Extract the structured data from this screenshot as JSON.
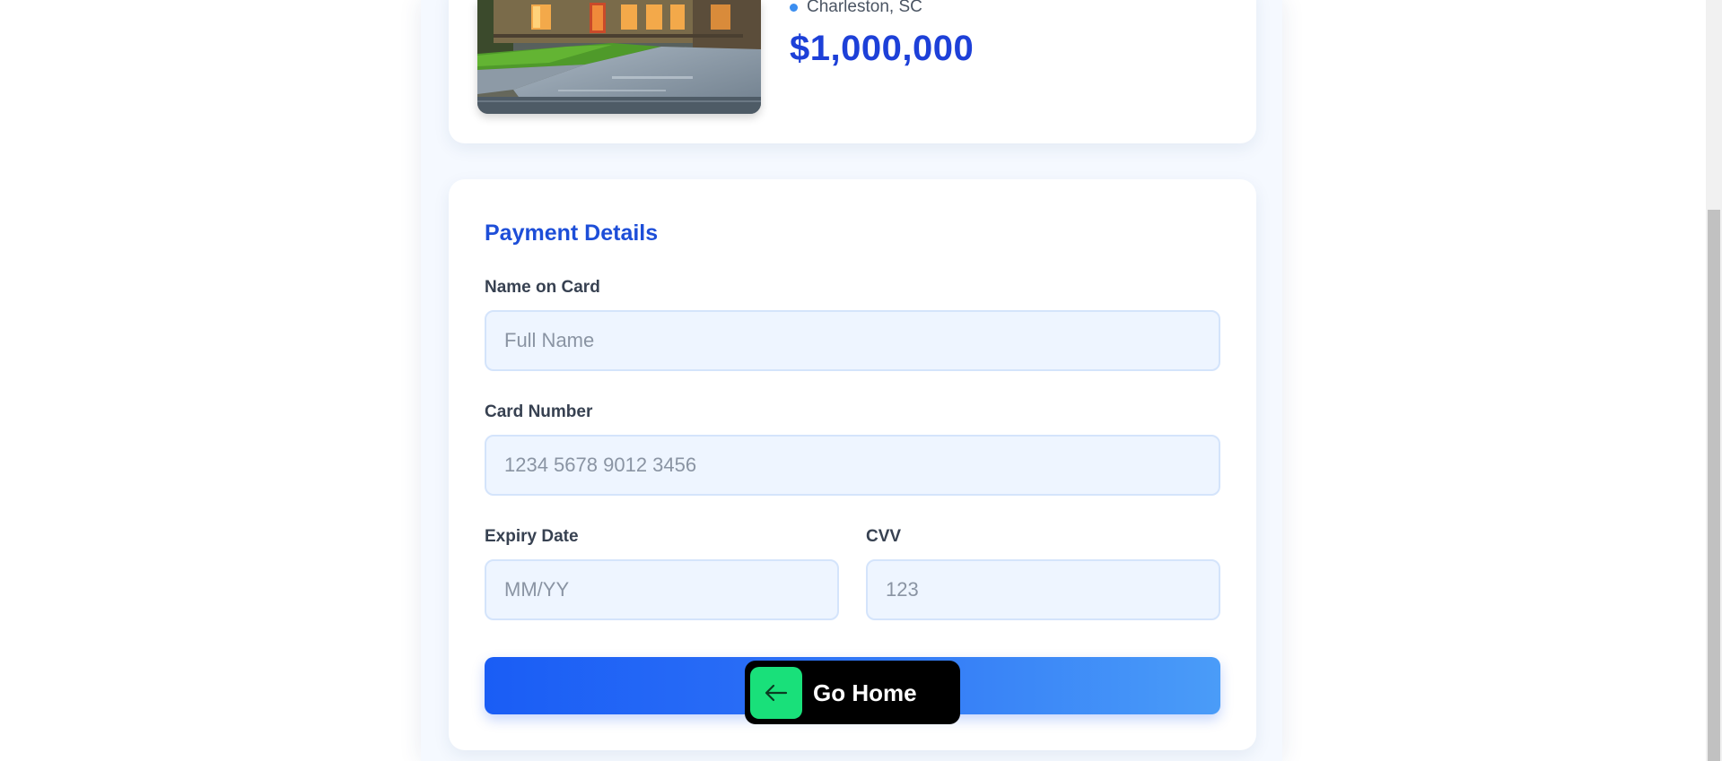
{
  "property": {
    "location": "Charleston, SC",
    "price": "$1,000,000",
    "image_alt": "house"
  },
  "payment": {
    "title": "Payment Details",
    "name_label": "Name on Card",
    "name_placeholder": "Full Name",
    "card_label": "Card Number",
    "card_placeholder": "1234 5678 9012 3456",
    "expiry_label": "Expiry Date",
    "expiry_placeholder": "MM/YY",
    "cvv_label": "CVV",
    "cvv_placeholder": "123"
  },
  "go_home": {
    "label": "Go Home",
    "icon": "arrow-left-icon"
  },
  "colors": {
    "accent": "#1d4ed8",
    "price": "#1d40d8",
    "go_home_icon_bg": "#19e07a",
    "input_bg": "#eef5ff",
    "location_dot": "#3b8ef0"
  },
  "scrollbar": {
    "position_fraction": 1.0
  }
}
